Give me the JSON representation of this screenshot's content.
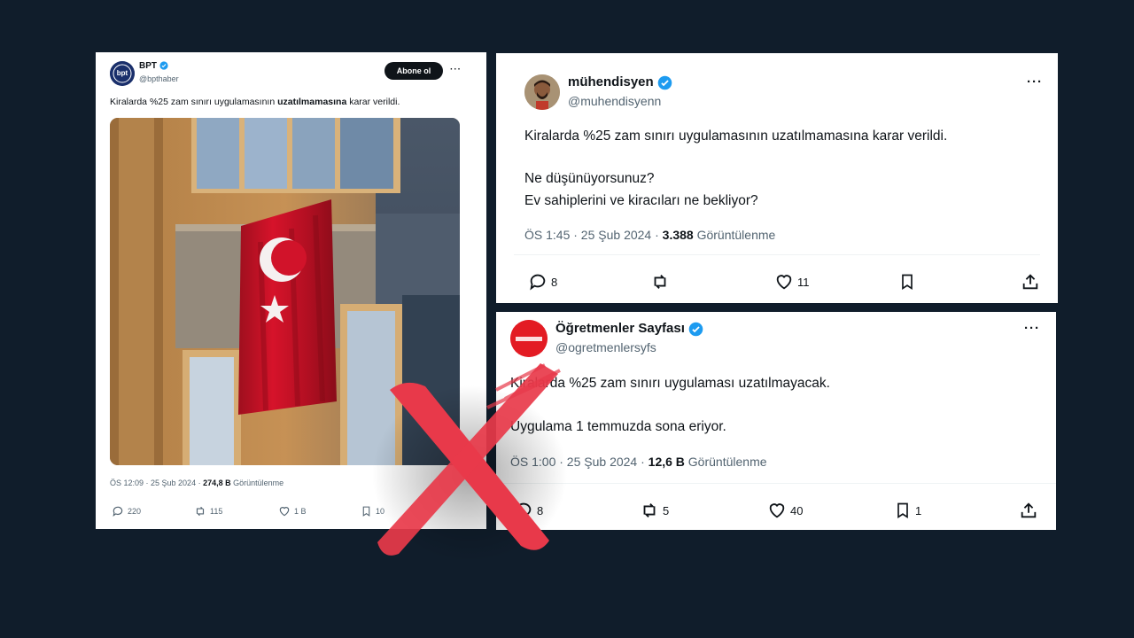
{
  "colors": {
    "background": "#101d2b",
    "verified_blue": "#1d9bf0",
    "cross_red": "#e8394a",
    "flag_red": "#c8102e"
  },
  "post1": {
    "author_name": "BPT",
    "avatar_text": "bpt",
    "handle": "@bpthaber",
    "follow_label": "Abone ol",
    "more_label": "···",
    "text_before": "Kiralarda %25 zam sınırı uygulamasının ",
    "text_bold": "uzatılmamasına",
    "text_after": " karar verildi.",
    "time": "ÖS 12:09 · 25 Şub 2024 · ",
    "views_count": "274,8 B",
    "views_label": " Görüntülenme",
    "replies": "220",
    "reposts": "115",
    "likes": "1 B",
    "bookmarks": "10"
  },
  "post2": {
    "author_name": "mühendisyen",
    "handle": "@muhendisyenn",
    "more_label": "···",
    "line1": "Kiralarda %25 zam sınırı uygulamasının uzatılmamasına karar verildi.",
    "line2": "Ne düşünüyorsunuz?",
    "line3": "Ev sahiplerini ve kiracıları ne bekliyor?",
    "time": "ÖS 1:45 · 25 Şub 2024 · ",
    "views_count": "3.388",
    "views_label": " Görüntülenme",
    "replies": "8",
    "likes": "11"
  },
  "post3": {
    "author_name": "Öğretmenler Sayfası",
    "handle": "@ogretmenlersyfs",
    "more_label": "···",
    "line1": "Kiralarda %25 zam sınırı uygulaması uzatılmayacak.",
    "line2": "Uygulama 1 temmuzda sona eriyor.",
    "time": "ÖS 1:00 · 25 Şub 2024 · ",
    "views_count": "12,6 B",
    "views_label": " Görüntülenme",
    "replies": "8",
    "reposts": "5",
    "likes": "40",
    "bookmarks": "1"
  }
}
